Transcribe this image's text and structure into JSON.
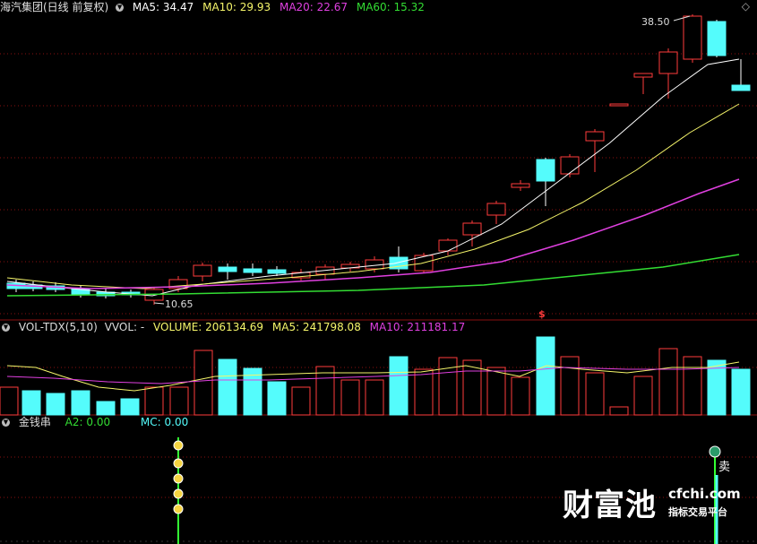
{
  "header": {
    "title": "海汽集团(日线 前复权)",
    "ma5": "MA5: 34.47",
    "ma10": "MA10: 29.93",
    "ma20": "MA20: 22.67",
    "ma60": "MA60: 15.32",
    "corner_icon": "diamond-icon"
  },
  "price_panel": {
    "high_label": "38.50",
    "low_label": "10.65",
    "signal_mark": "$"
  },
  "volume_panel": {
    "name": "VOL-TDX(5,10)",
    "vvol": "VVOL: -",
    "volume": "VOLUME: 206134.69",
    "ma5": "MA5: 241798.08",
    "ma10": "MA10: 211181.17"
  },
  "indicator_panel": {
    "name": "金钱串",
    "a2": "A2: 0.00",
    "mc": "MC: 0.00",
    "sell_label": "卖"
  },
  "watermark": {
    "brand": "财富池",
    "url": "cfchi.com",
    "tagline": "指标交易平台"
  },
  "colors": {
    "up": "#ff3b3b",
    "down": "#54fcfc",
    "ma5": "#ffffff",
    "ma10": "#f5f56a",
    "ma20": "#e040e0",
    "ma60": "#33dd33",
    "grid": "#8a1010"
  }
}
